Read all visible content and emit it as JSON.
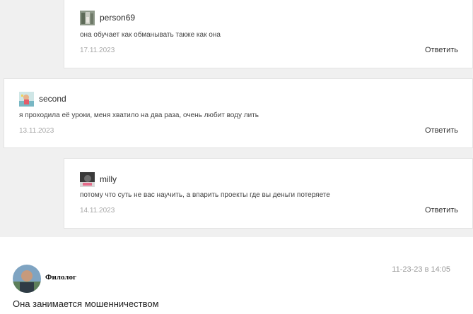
{
  "comments": [
    {
      "author": "person69",
      "text": "она обучает как обманывать также как она",
      "date": "17.11.2023",
      "reply_label": "Ответить"
    },
    {
      "author": "second",
      "text": "я проходила её уроки, меня хватило на два раза, очень любит воду лить",
      "date": "13.11.2023",
      "reply_label": "Ответить"
    },
    {
      "author": "milly",
      "text": "потому что суть не вас научить, а впарить проекты где вы деньги потеряете",
      "date": "14.11.2023",
      "reply_label": "Ответить"
    }
  ],
  "post": {
    "author": "Филолог",
    "time": "11-23-23 в 14:05",
    "text": "Она занимается мошенничеством"
  },
  "colors": {
    "background_band": "#f0f0f0",
    "card": "#ffffff",
    "date": "#a7a7a7"
  }
}
